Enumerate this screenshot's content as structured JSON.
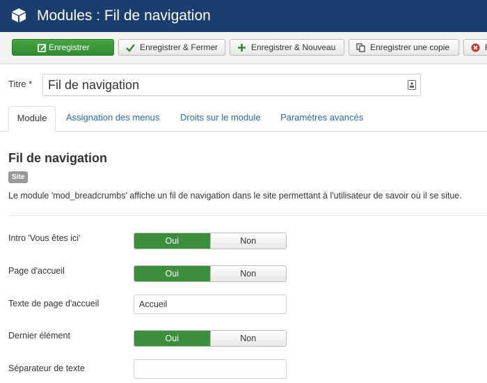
{
  "header": {
    "title": "Modules : Fil de navigation",
    "icon": "cube-icon"
  },
  "toolbar": {
    "save": "Enregistrer",
    "save_close": "Enregistrer & Fermer",
    "save_new": "Enregistrer & Nouveau",
    "save_copy": "Enregistrer une copie",
    "close_partial": "F"
  },
  "form": {
    "title_label": "Titre *",
    "title_value": "Fil de navigation"
  },
  "tabs": [
    "Module",
    "Assignation des menus",
    "Droits sur le module",
    "Paramètres avancés"
  ],
  "module": {
    "heading": "Fil de navigation",
    "badge": "Site",
    "description": "Le module 'mod_breadcrumbs' affiche un fil de navigation dans le site permettant à l'utilisateur de savoir où il se situe."
  },
  "fields": {
    "intro": {
      "label": "Intro 'Vous êtes ici'",
      "yes": "Oui",
      "no": "Non",
      "selected": "Oui"
    },
    "home": {
      "label": "Page d'accueil",
      "yes": "Oui",
      "no": "Non",
      "selected": "Oui"
    },
    "home_text": {
      "label": "Texte de page d'accueil",
      "value": "Accueil"
    },
    "last": {
      "label": "Dernier élément",
      "yes": "Oui",
      "no": "Non",
      "selected": "Oui"
    },
    "separator": {
      "label": "Séparateur de texte",
      "value": ""
    }
  },
  "colors": {
    "header_bg": "#1b3e6f",
    "save_green": "#46a546",
    "toggle_on": "#3c8d3c",
    "link_blue": "#2a6aa6"
  }
}
